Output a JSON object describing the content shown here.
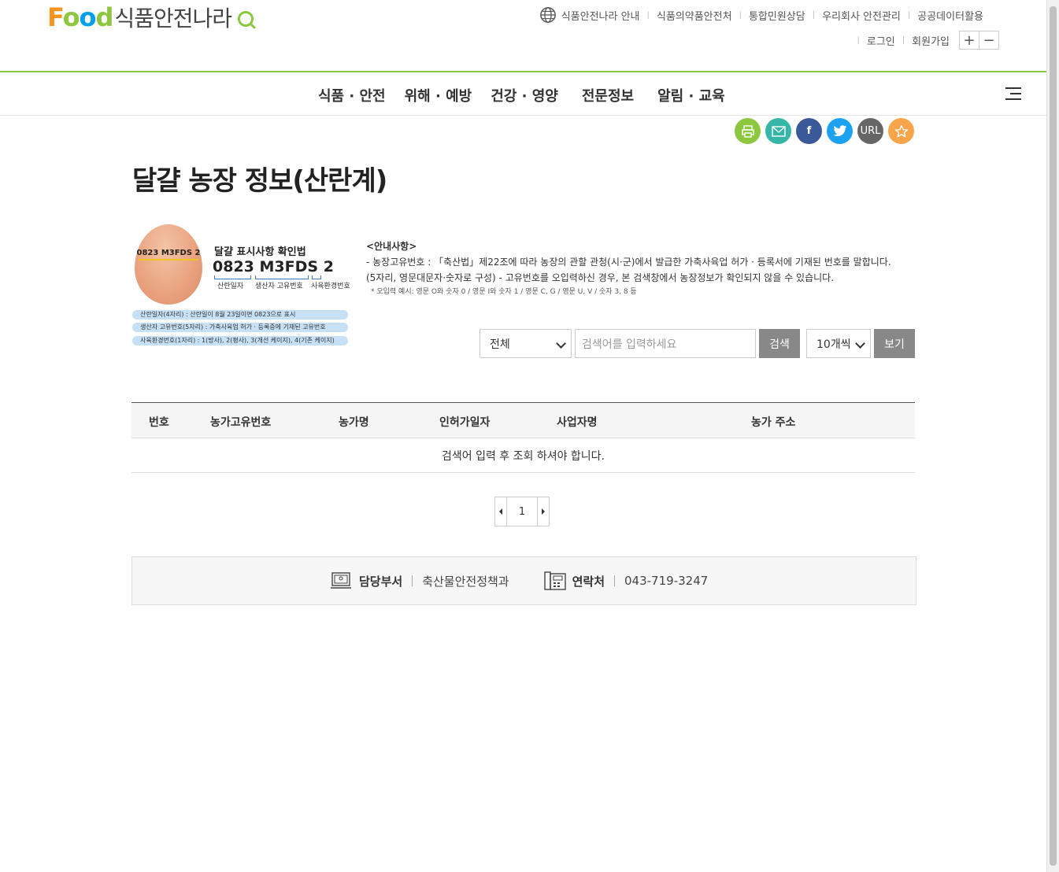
{
  "header": {
    "logo_food": "Food",
    "logo_kr": "식품안전나라",
    "util_links": [
      "식품안전나라 안내",
      "식품의약품안전처",
      "통합민원상담",
      "우리회사 안전관리",
      "공공데이터활용"
    ],
    "auth_links": [
      "로그인",
      "회원가입"
    ],
    "zoom_in": "+",
    "zoom_out": "−"
  },
  "gnb": {
    "items": [
      "식품 · 안전",
      "위해 · 예방",
      "건강 · 영양",
      "전문정보",
      "알림 · 교육"
    ]
  },
  "share": {
    "url_label": "URL"
  },
  "page": {
    "title": "달걀 농장 정보(산란계)"
  },
  "egg_guide": {
    "egg_code": "0823 M3FDS 2",
    "heading": "달걀 표시사항 확인법",
    "code_part1": "0823",
    "code_part2": "M3FDS",
    "code_part3": "2",
    "label1": "산란일자",
    "label2": "생산자 고유번호",
    "label3": "사육환경번호",
    "pills": [
      "산란일자(4자리) : 산란일이 8월 23일이면 0823으로 표시",
      "생산자 고유번호(5자리) : 가축사육업 허가 · 등록증에 기재된 고유번호",
      "사육환경번호(1자리) : 1(방사), 2(평사), 3(개선 케이지), 4(기존 케이지)"
    ]
  },
  "notice": {
    "title": "<안내사항>",
    "line1": "- 농장고유번호 : 「축산법」제22조에 따라 농장의 관할 관청(시·군)에서 발급한 가축사육업 허가 · 등록서에 기재된 번호를 말합니다.",
    "line2": "(5자리, 영문대문자·숫자로 구성) - 고유번호를 오입력하신 경우, 본 검색창에서 농장정보가 확인되지 않을 수 있습니다.",
    "line3": "* 오입력 예시: 영문 O와 숫자 0 / 영문 I와 숫자 1 / 영문 C, G / 영문 U, V / 숫자 3, 8 등"
  },
  "search": {
    "category": "전체",
    "placeholder": "검색어를 입력하세요",
    "search_button": "검색",
    "page_size": "10개씩",
    "view_button": "보기"
  },
  "table": {
    "headers": [
      "번호",
      "농가고유번호",
      "농가명",
      "인허가일자",
      "사업자명",
      "농가 주소"
    ],
    "empty_message": "검색어 입력 후 조회 하셔야 합니다."
  },
  "pagination": {
    "current": "1"
  },
  "contact": {
    "dept_label": "담당부서",
    "dept_value": "축산물안전정책과",
    "phone_label": "연락처",
    "phone_value": "043-719-3247"
  }
}
